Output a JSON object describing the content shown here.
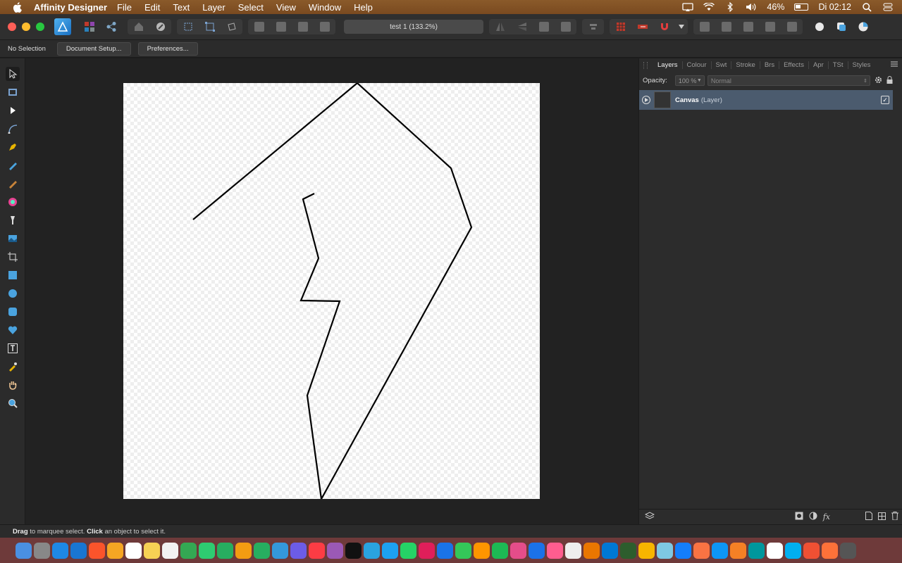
{
  "menubar": {
    "app_name": "Affinity Designer",
    "items": [
      "File",
      "Edit",
      "Text",
      "Layer",
      "Select",
      "View",
      "Window",
      "Help"
    ],
    "battery": "46%",
    "clock": "Di 02:12"
  },
  "toolbar": {
    "document_title": "test 1 (133.2%)"
  },
  "context": {
    "selection": "No Selection",
    "document_setup": "Document Setup...",
    "preferences": "Preferences..."
  },
  "panel": {
    "tabs": [
      "Layers",
      "Colour",
      "Swt",
      "Stroke",
      "Brs",
      "Effects",
      "Apr",
      "TSt",
      "Styles"
    ],
    "opacity_label": "Opacity:",
    "opacity_value": "100 %",
    "blend_mode": "Normal",
    "layers": [
      {
        "name": "Canvas",
        "type": "(Layer)",
        "visible": true
      }
    ]
  },
  "status": {
    "drag": "Drag",
    "drag_text": " to marquee select. ",
    "click": "Click",
    "click_text": " an object to select it."
  },
  "colors": {
    "menubar": "#7e4e24",
    "accent_layer": "#4b5b6e",
    "dock": "#6e3a3a"
  },
  "dock_icons": [
    "finder",
    "system-preferences",
    "app-store",
    "safari",
    "brave",
    "photos",
    "calendar",
    "notes",
    "reminders",
    "chrome",
    "messages",
    "facetime",
    "pages",
    "numbers",
    "keynote",
    "imovie",
    "music",
    "podcasts",
    "apple-tv",
    "telegram",
    "twitter",
    "whatsapp",
    "slack",
    "sync",
    "maps",
    "home",
    "spotify",
    "affinity-publisher",
    "affinity-designer",
    "affinity-photo",
    "preview",
    "blender",
    "vscode",
    "box",
    "sketch",
    "photo-app",
    "xcode",
    "swift",
    "appstore2",
    "pixelmator",
    "arduino",
    "mail",
    "skype",
    "git",
    "firefox",
    "trash"
  ]
}
